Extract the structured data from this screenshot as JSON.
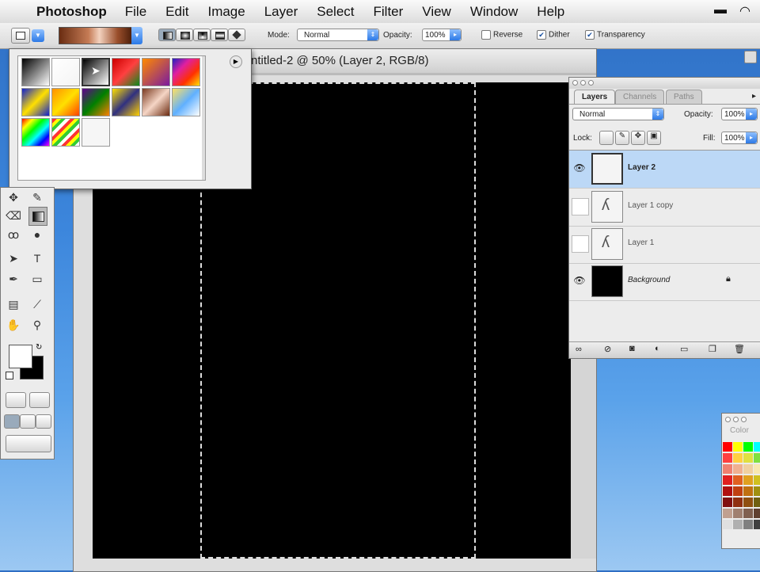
{
  "menubar": {
    "app": "Photoshop",
    "items": [
      "File",
      "Edit",
      "Image",
      "Layer",
      "Select",
      "Filter",
      "View",
      "Window",
      "Help"
    ]
  },
  "options": {
    "mode_label": "Mode:",
    "mode_value": "Normal",
    "opacity_label": "Opacity:",
    "opacity_value": "100%",
    "reverse_label": "Reverse",
    "dither_label": "Dither",
    "transparency_label": "Transparency",
    "reverse_checked": false,
    "dither_checked": true,
    "transparency_checked": true
  },
  "document": {
    "title": "ntitled-2 @ 50% (Layer 2, RGB/8)"
  },
  "layers_panel": {
    "tabs": [
      "Layers",
      "Channels",
      "Paths"
    ],
    "blend_mode": "Normal",
    "opacity_label": "Opacity:",
    "opacity_value": "100%",
    "lock_label": "Lock:",
    "fill_label": "Fill:",
    "fill_value": "100%",
    "layers": [
      {
        "name": "Layer 2",
        "visible": true,
        "selected": true
      },
      {
        "name": "Layer 1 copy",
        "visible": false,
        "selected": false
      },
      {
        "name": "Layer 1",
        "visible": false,
        "selected": false
      },
      {
        "name": "Background",
        "visible": true,
        "selected": false,
        "locked": true
      }
    ]
  },
  "color_panel": {
    "tab": "Color"
  }
}
